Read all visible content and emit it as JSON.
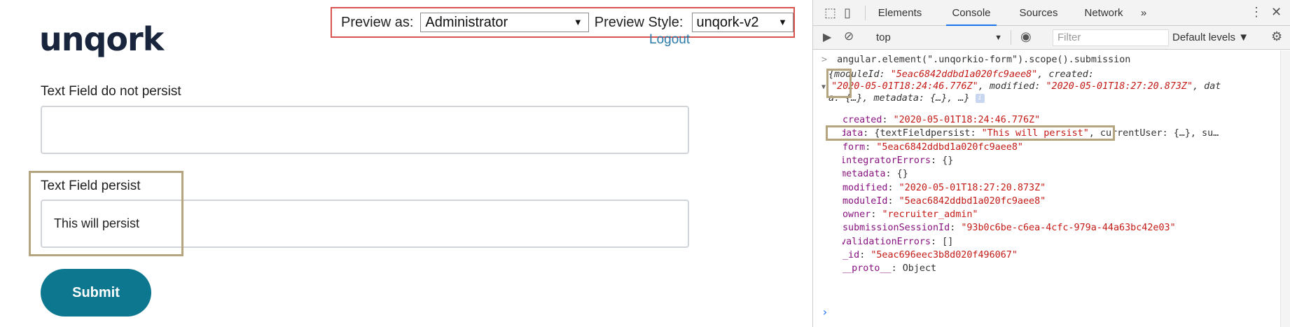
{
  "app": {
    "logo": "unqork",
    "preview": {
      "label_as": "Preview as:",
      "role_value": "Administrator",
      "label_style": "Preview Style:",
      "style_value": "unqork-v2"
    },
    "logout": "Logout",
    "fields": [
      {
        "label": "Text Field do not persist",
        "value": ""
      },
      {
        "label": "Text Field persist",
        "value": "This will persist"
      }
    ],
    "submit_label": "Submit",
    "colors": {
      "logo": "#18253d",
      "submit": "#0e7790",
      "highlight": "#b5a57e",
      "preview_border": "#d9534f"
    }
  },
  "devtools": {
    "tabs": [
      "Elements",
      "Console",
      "Sources",
      "Network"
    ],
    "active_tab": "Console",
    "more_tabs": "»",
    "context": "top",
    "filter_placeholder": "Filter",
    "levels": "Default levels ▼",
    "command": "angular.element(\".unqorkio-form\").scope().submission",
    "summary": {
      "line1_a": "{moduleId: ",
      "line1_b": "\"5eac6842ddbd1a020fc9aee8\"",
      "line1_c": ", created:",
      "line2_a": "\"2020-05-01T18:24:46.776Z\"",
      "line2_b": ", modified: ",
      "line2_c": "\"2020-05-01T18:27:20.873Z\"",
      "line2_d": ", dat",
      "line3": "a: {…}, metadata: {…}, …}",
      "info": "i"
    },
    "props": [
      {
        "key": "created",
        "value": "\"2020-05-01T18:24:46.776Z\"",
        "expandable": false,
        "type": "str"
      },
      {
        "key": "data",
        "value": "{textFieldpersist: \"This will persist\", currentUser: {…}, su…",
        "expandable": true,
        "type": "mixed"
      },
      {
        "key": "form",
        "value": "\"5eac6842ddbd1a020fc9aee8\"",
        "expandable": false,
        "type": "str"
      },
      {
        "key": "integratorErrors",
        "value": "{}",
        "expandable": true,
        "type": "plain"
      },
      {
        "key": "metadata",
        "value": "{}",
        "expandable": true,
        "type": "plain"
      },
      {
        "key": "modified",
        "value": "\"2020-05-01T18:27:20.873Z\"",
        "expandable": false,
        "type": "str"
      },
      {
        "key": "moduleId",
        "value": "\"5eac6842ddbd1a020fc9aee8\"",
        "expandable": false,
        "type": "str"
      },
      {
        "key": "owner",
        "value": "\"recruiter_admin\"",
        "expandable": false,
        "type": "str"
      },
      {
        "key": "submissionSessionId",
        "value": "\"93b0c6be-c6ea-4cfc-979a-44a63bc42e03\"",
        "expandable": false,
        "type": "str"
      },
      {
        "key": "validationErrors",
        "value": "[]",
        "expandable": true,
        "type": "plain"
      },
      {
        "key": "_id",
        "value": "\"5eac696eec3b8d020f496067\"",
        "expandable": false,
        "type": "str"
      },
      {
        "key": "__proto__",
        "value": "Object",
        "expandable": true,
        "type": "plain"
      }
    ],
    "data_parts": {
      "open": "{textFieldpersist: ",
      "str": "\"This will persist\"",
      "rest": ", currentUser: {…}, su…"
    }
  }
}
